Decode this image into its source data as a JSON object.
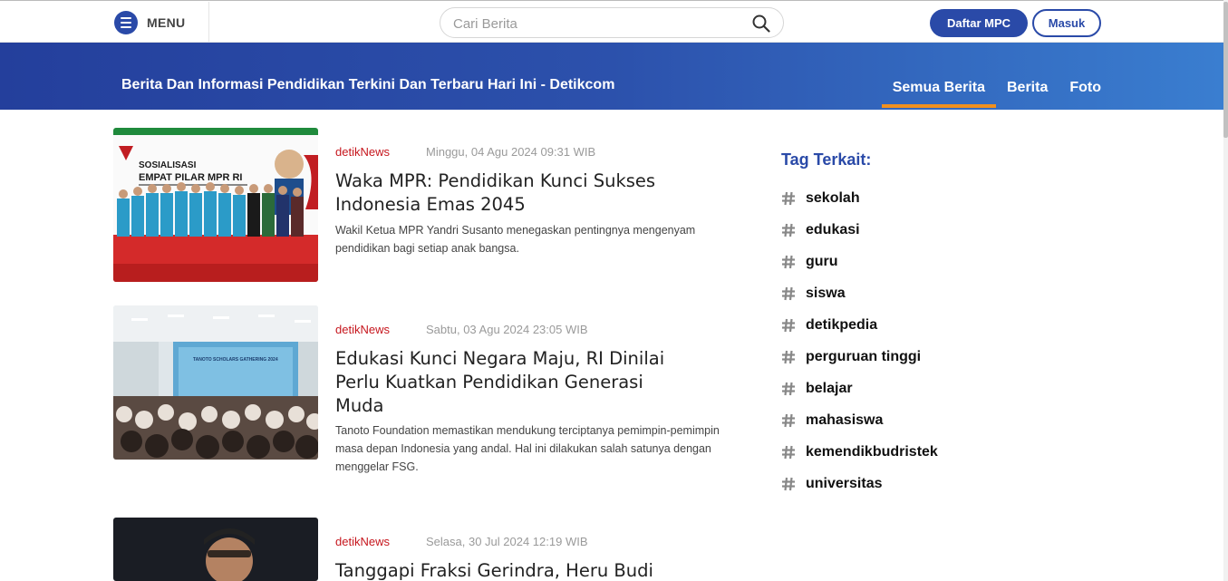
{
  "header": {
    "menu_label": "MENU",
    "search_placeholder": "Cari Berita",
    "daftar_label": "Daftar MPC",
    "masuk_label": "Masuk"
  },
  "banner": {
    "title": "Berita Dan Informasi Pendidikan Terkini Dan Terbaru Hari Ini - Detikcom",
    "tabs": [
      {
        "label": "Semua Berita",
        "active": true
      },
      {
        "label": "Berita",
        "active": false
      },
      {
        "label": "Foto",
        "active": false
      }
    ]
  },
  "articles": [
    {
      "source": "detikNews",
      "date": "Minggu, 04 Agu 2024 09:31 WIB",
      "title": "Waka MPR: Pendidikan Kunci Sukses Indonesia Emas 2045",
      "description": "Wakil Ketua MPR Yandri Susanto menegaskan pentingnya mengenyam pendidikan bagi setiap anak bangsa.",
      "image_text_1": "SOSIALISASI",
      "image_text_2": "EMPAT PILAR MPR RI"
    },
    {
      "source": "detikNews",
      "date": "Sabtu, 03 Agu 2024 23:05 WIB",
      "title": "Edukasi Kunci Negara Maju, RI Dinilai Perlu Kuatkan Pendidikan Generasi Muda",
      "description": "Tanoto Foundation memastikan mendukung terciptanya pemimpin-pemimpin masa depan Indonesia yang andal. Hal ini dilakukan salah satunya dengan menggelar FSG.",
      "image_text_1": "TANOTO SCHOLARS GATHERING 2024"
    },
    {
      "source": "detikNews",
      "date": "Selasa, 30 Jul 2024 12:19 WIB",
      "title": "Tanggapi Fraksi Gerindra, Heru Budi",
      "description": ""
    }
  ],
  "sidebar": {
    "heading": "Tag Terkait:",
    "tags": [
      "sekolah",
      "edukasi",
      "guru",
      "siswa",
      "detikpedia",
      "perguruan tinggi",
      "belajar",
      "mahasiswa",
      "kemendikbudristek",
      "universitas"
    ]
  },
  "colors": {
    "brand_blue": "#2a4aa8",
    "active_tab_underline": "#f0901f",
    "source_red": "#c6161d"
  }
}
